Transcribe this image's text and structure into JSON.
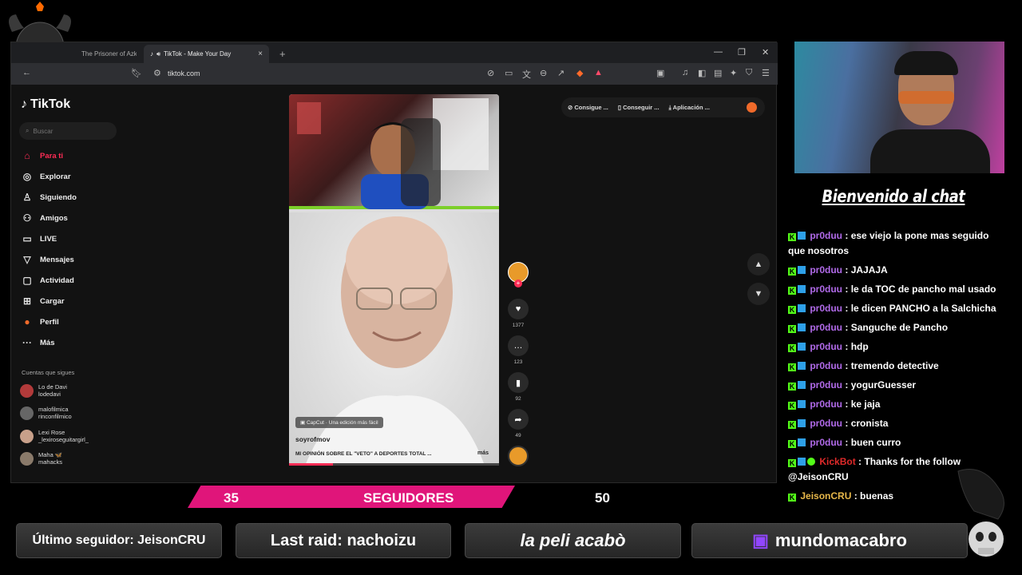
{
  "browser": {
    "tabs": [
      {
        "title": "The Prisoner of Azka"
      },
      {
        "title": "TikTok - Make Your Day",
        "active": true
      }
    ],
    "url": "tiktok.com"
  },
  "tiktok": {
    "logo": "TikTok",
    "search_placeholder": "Buscar",
    "nav": [
      {
        "label": "Para ti",
        "icon": "home-icon",
        "active": true
      },
      {
        "label": "Explorar",
        "icon": "compass-icon"
      },
      {
        "label": "Siguiendo",
        "icon": "user-follow-icon"
      },
      {
        "label": "Amigos",
        "icon": "friends-icon"
      },
      {
        "label": "LIVE",
        "icon": "live-icon"
      },
      {
        "label": "Mensajes",
        "icon": "send-icon"
      },
      {
        "label": "Actividad",
        "icon": "activity-icon"
      },
      {
        "label": "Cargar",
        "icon": "upload-icon"
      },
      {
        "label": "Perfil",
        "icon": "avatar-icon"
      },
      {
        "label": "Más",
        "icon": "more-icon"
      }
    ],
    "following_title": "Cuentas que sigues",
    "following": [
      {
        "line1": "Lo de Davi",
        "line2": "lodedavi"
      },
      {
        "line1": "malofilmica",
        "line2": "rinconfilmico"
      },
      {
        "line1": "Lexi Rose",
        "line2": "_lexiroseguitargirl_"
      },
      {
        "line1": "Maha 🦋",
        "line2": "mahacks"
      }
    ],
    "top_pills": [
      "Consigue ...",
      "Conseguir ...",
      "Aplicación ..."
    ],
    "video": {
      "capcut": "CapCut · Una edición más fácil",
      "author": "soyrofmov",
      "description": "MI OPINIÓN SOBRE EL \"VETO\" A DEPORTES TOTAL ...",
      "more": "más",
      "progress": 0.21
    },
    "actions": {
      "likes": "1377",
      "comments": "123",
      "saves": "92",
      "shares": "49"
    }
  },
  "chat": {
    "title": "Bienvenido al chat",
    "messages": [
      {
        "user": "pr0duu",
        "text": ": ese viejo la pone mas seguido",
        "cont": "que nosotros"
      },
      {
        "user": "pr0duu",
        "text": ": JAJAJA"
      },
      {
        "user": "pr0duu",
        "text": ": le da TOC de pancho mal usado"
      },
      {
        "user": "pr0duu",
        "text": ": le dicen PANCHO a la Salchicha"
      },
      {
        "user": "pr0duu",
        "text": ": Sanguche de Pancho"
      },
      {
        "user": "pr0duu",
        "text": ": hdp"
      },
      {
        "user": "pr0duu",
        "text": ": tremendo detective"
      },
      {
        "user": "pr0duu",
        "text": ": yogurGuesser"
      },
      {
        "user": "pr0duu",
        "text": ": ke jaja"
      },
      {
        "user": "pr0duu",
        "text": ": cronista"
      },
      {
        "user": "pr0duu",
        "text": ": buen curro"
      },
      {
        "user": "KickBot",
        "text": ": Thanks for the follow",
        "cont": "@JeisonCRU"
      },
      {
        "user": "JeisonCRU",
        "text": ": buenas"
      }
    ]
  },
  "followers_goal": {
    "current": "35",
    "label": "SEGUIDORES",
    "goal": "50"
  },
  "footer": {
    "last_follower": "Último seguidor: JeisonCRU",
    "last_raid": "Last raid: nachoizu",
    "ticker": "la peli acabò",
    "channel": "mundomacabro"
  },
  "colors": {
    "tiktok_red": "#fe2c55",
    "chat_user": "#b06ae8",
    "kick_green": "#53fc18",
    "goal_bar": "#e0157a"
  }
}
